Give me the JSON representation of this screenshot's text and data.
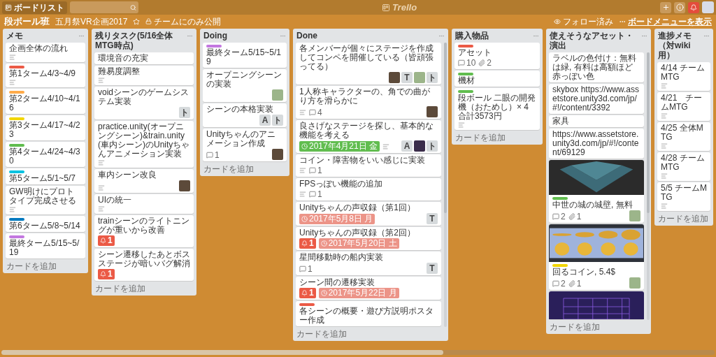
{
  "topbar": {
    "boards_button": "ボードリスト",
    "logo": "Trello"
  },
  "board": {
    "title": "段ボール班",
    "team": "五月祭VR企画2017",
    "starred": false,
    "visibility": "チームにのみ公開",
    "follow": "フォロー済み",
    "menu": "ボードメニューを表示"
  },
  "lists": [
    {
      "title": "メモ",
      "scroll": false,
      "cards": [
        {
          "title": "企画全体の流れ",
          "badges": [
            {
              "kind": "description"
            }
          ]
        },
        {
          "labels": [
            {
              "color": "#eb5a46"
            }
          ],
          "title": "第1ターム4/3~4/9",
          "badges": [
            {
              "kind": "description"
            }
          ]
        },
        {
          "labels": [
            {
              "color": "#ffab4a"
            }
          ],
          "title": "第2ターム4/10~4/16"
        },
        {
          "labels": [
            {
              "color": "#f2d600"
            }
          ],
          "title": "第3ターム4/17~4/23"
        },
        {
          "labels": [
            {
              "color": "#61bd4f"
            }
          ],
          "title": "第4ターム4/24~4/30"
        },
        {
          "labels": [
            {
              "color": "#00c2e0"
            }
          ],
          "title": "第5ターム5/1~5/7"
        },
        {
          "title": "GW明けにプロトタイプ完成させる",
          "badges": [
            {
              "kind": "description"
            }
          ]
        },
        {
          "labels": [
            {
              "color": "#0079bf"
            }
          ],
          "title": "第6ターム5/8~5/14"
        },
        {
          "labels": [
            {
              "color": "#c377e0"
            }
          ],
          "title": "最終ターム5/15~5/19"
        }
      ],
      "add": "カードを追加"
    },
    {
      "title": "残りタスク(5/16全体MTG時点)",
      "scroll": false,
      "cards": [
        {
          "title": "環境音の充実"
        },
        {
          "title": "難易度調整",
          "badges": [
            {
              "kind": "description"
            }
          ]
        },
        {
          "title": "voidシーンのゲームシステム実装",
          "members": [
            {
              "kind": "initials",
              "text": "ト"
            }
          ]
        },
        {
          "title": "practice.unity(オープニングシーン)&train.unity(車内シーン)のUnityちゃんアニメーション実装",
          "badges": [
            {
              "kind": "description"
            }
          ]
        },
        {
          "title": "車内シーン改良",
          "badges": [
            {
              "kind": "description"
            }
          ],
          "members": [
            {
              "kind": "photo"
            }
          ]
        },
        {
          "title": "UIの統一",
          "badges": [
            {
              "kind": "description"
            }
          ]
        },
        {
          "title": "trainシーンのライトニングが重いから改善",
          "badges": [
            {
              "kind": "notifications",
              "text": "1"
            }
          ]
        },
        {
          "title": "シーン遷移したあとボスステージが暗いバグ解消",
          "badges": [
            {
              "kind": "notifications",
              "text": "1"
            }
          ]
        }
      ],
      "add": "カードを追加"
    },
    {
      "title": "Doing",
      "scroll": false,
      "cards": [
        {
          "labels": [
            {
              "color": "#c377e0"
            }
          ],
          "title": "最終ターム5/15~5/19"
        },
        {
          "title": "オープニングシーンの実装",
          "members": [
            {
              "kind": "cartoon"
            }
          ]
        },
        {
          "title": "シーンの本格実装",
          "members": [
            {
              "kind": "initials",
              "text": "A"
            },
            {
              "kind": "initials",
              "text": "ト"
            }
          ]
        },
        {
          "title": "Unityちゃんのアニメーション作成",
          "badges": [
            {
              "kind": "comments",
              "text": "1"
            }
          ],
          "members": [
            {
              "kind": "photo"
            }
          ]
        }
      ],
      "add": "カードを追加"
    },
    {
      "title": "Done",
      "scroll": true,
      "cards": [
        {
          "title": "各メンバーが個々にステージを作成してコンペを開催している（皆頑張ってる）",
          "members": [
            {
              "kind": "photo"
            },
            {
              "kind": "initials",
              "text": "T"
            },
            {
              "kind": "cartoon"
            },
            {
              "kind": "initials",
              "text": "ト"
            }
          ]
        },
        {
          "title": "1人称キャラクターの、角での曲がり方を滑らかに",
          "badges": [
            {
              "kind": "description"
            },
            {
              "kind": "comments",
              "text": "4"
            }
          ],
          "members": [
            {
              "kind": "photo"
            }
          ]
        },
        {
          "title": "良さげなステージを探し、基本的な機能を考える",
          "badges": [
            {
              "kind": "due",
              "text": "2017年4月21日 金",
              "color": "#61bd4f"
            },
            {
              "kind": "description"
            }
          ],
          "members": [
            {
              "kind": "initials",
              "text": "A"
            },
            {
              "kind": "dark"
            },
            {
              "kind": "initials",
              "text": "ト"
            }
          ]
        },
        {
          "title": "コイン・障害物をいい感じに実装",
          "badges": [
            {
              "kind": "description"
            },
            {
              "kind": "comments",
              "text": "1"
            }
          ]
        },
        {
          "title": "FPSっぽい機能の追加",
          "badges": [
            {
              "kind": "description"
            },
            {
              "kind": "comments",
              "text": "1"
            }
          ]
        },
        {
          "title": "Unityちゃんの声収録（第1回）",
          "badges": [
            {
              "kind": "due",
              "text": "2017年5月8日 月",
              "color": "#ec9488"
            }
          ],
          "members": [
            {
              "kind": "initials",
              "text": "T"
            }
          ]
        },
        {
          "title": "Unityちゃんの声収録（第2回）",
          "badges": [
            {
              "kind": "notifications",
              "text": "1"
            },
            {
              "kind": "due",
              "text": "2017年5月20日 土",
              "color": "#ec9488"
            }
          ]
        },
        {
          "title": "星間移動時の船内実装",
          "badges": [
            {
              "kind": "comments",
              "text": "1"
            }
          ],
          "members": [
            {
              "kind": "initials",
              "text": "T"
            }
          ]
        },
        {
          "title": "シーン間の遷移実装",
          "badges": [
            {
              "kind": "notifications",
              "text": "1"
            },
            {
              "kind": "due",
              "text": "2017年5月22日 月",
              "color": "#ec9488"
            }
          ]
        },
        {
          "title": "各シーンの概要・遊び方説明ポスター作成",
          "labels": [
            {
              "color": "#eb5a46"
            }
          ]
        }
      ],
      "add": "カードを追加"
    },
    {
      "title": "購入物品",
      "scroll": false,
      "cards": [
        {
          "labels": [
            {
              "color": "#eb5a46"
            }
          ],
          "title": "アセット",
          "badges": [
            {
              "kind": "comments",
              "text": "10"
            },
            {
              "kind": "attachments",
              "text": "2"
            }
          ]
        },
        {
          "labels": [
            {
              "color": "#61bd4f"
            }
          ],
          "title": "機材"
        },
        {
          "labels": [
            {
              "color": "#61bd4f"
            }
          ],
          "title": "段ボール 二眼の開発機（おためし）× 4 合計3573円",
          "badges": [
            {
              "kind": "description"
            }
          ]
        }
      ],
      "add": "カードを追加"
    },
    {
      "title": "使えそうなアセット・演出",
      "scroll": true,
      "cards": [
        {
          "title": "ラベルの色付け：無料は緑, 有料は高額ほど赤っぽい色"
        },
        {
          "title": "skybox https://www.assetstore.unity3d.com/jp/#!/content/3392"
        },
        {
          "title": "家具"
        },
        {
          "title": "https://www.assetstore.unity3d.com/jp/#!/content/69129"
        },
        {
          "cover": {
            "kind": "castle"
          },
          "labels": [
            {
              "color": "#61bd4f"
            }
          ],
          "title": "中世の城の城壁, 無料",
          "badges": [
            {
              "kind": "comments",
              "text": "2"
            },
            {
              "kind": "attachments",
              "text": "1"
            }
          ],
          "members": [
            {
              "kind": "cartoon"
            }
          ]
        },
        {
          "cover": {
            "kind": "coins"
          },
          "labels": [
            {
              "color": "#f2d600"
            }
          ],
          "title": "回るコイン, 5.4$",
          "badges": [
            {
              "kind": "comments",
              "text": "2"
            },
            {
              "kind": "attachments",
              "text": "1"
            }
          ],
          "members": [
            {
              "kind": "cartoon"
            }
          ]
        },
        {
          "cover": {
            "kind": "grid"
          }
        }
      ],
      "add": "カードを追加"
    },
    {
      "title": "進捗メモ（対wiki用）",
      "scroll": false,
      "cards": [
        {
          "title": "4/14 チームMTG",
          "badges": [
            {
              "kind": "description"
            }
          ]
        },
        {
          "title": "4/21　チームMTG",
          "badges": [
            {
              "kind": "description"
            }
          ]
        },
        {
          "title": "4/25 全体MTG",
          "badges": [
            {
              "kind": "description"
            }
          ]
        },
        {
          "title": "4/28 チームMTG",
          "badges": [
            {
              "kind": "description"
            }
          ]
        },
        {
          "title": "5/5 チームMTG",
          "badges": [
            {
              "kind": "description"
            }
          ]
        }
      ],
      "add": "カードを追加"
    }
  ]
}
